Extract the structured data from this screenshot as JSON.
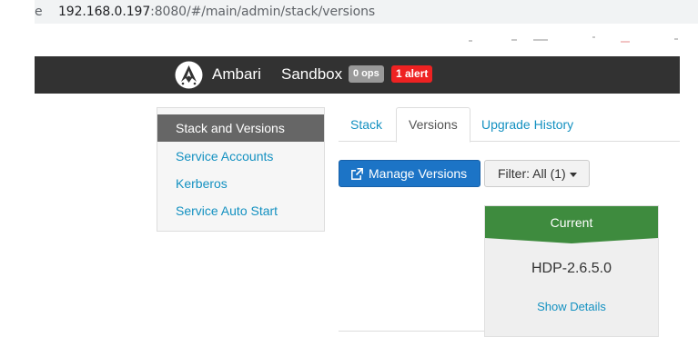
{
  "browser": {
    "edge_char": "e",
    "url_host": "192.168.0.197",
    "url_rest": ":8080/#/main/admin/stack/versions"
  },
  "navbar": {
    "brand": "Ambari",
    "cluster_name": "Sandbox",
    "ops_badge": "0 ops",
    "alert_badge": "1 alert"
  },
  "sidebar": {
    "items": [
      {
        "label": "Stack and Versions",
        "active": true
      },
      {
        "label": "Service Accounts",
        "active": false
      },
      {
        "label": "Kerberos",
        "active": false
      },
      {
        "label": "Service Auto Start",
        "active": false
      }
    ]
  },
  "tabs": [
    {
      "label": "Stack",
      "active": false
    },
    {
      "label": "Versions",
      "active": true
    },
    {
      "label": "Upgrade History",
      "active": false
    }
  ],
  "toolbar": {
    "manage_versions_label": "Manage Versions",
    "filter_label": "Filter: All (1)"
  },
  "version_card": {
    "status": "Current",
    "status_color": "#3e8b3e",
    "version": "HDP-2.6.5.0",
    "details_link": "Show Details"
  },
  "colors": {
    "navbar_bg": "#323232",
    "link": "#1491c1",
    "primary_button": "#1c74c6",
    "alert": "#ee2222"
  }
}
